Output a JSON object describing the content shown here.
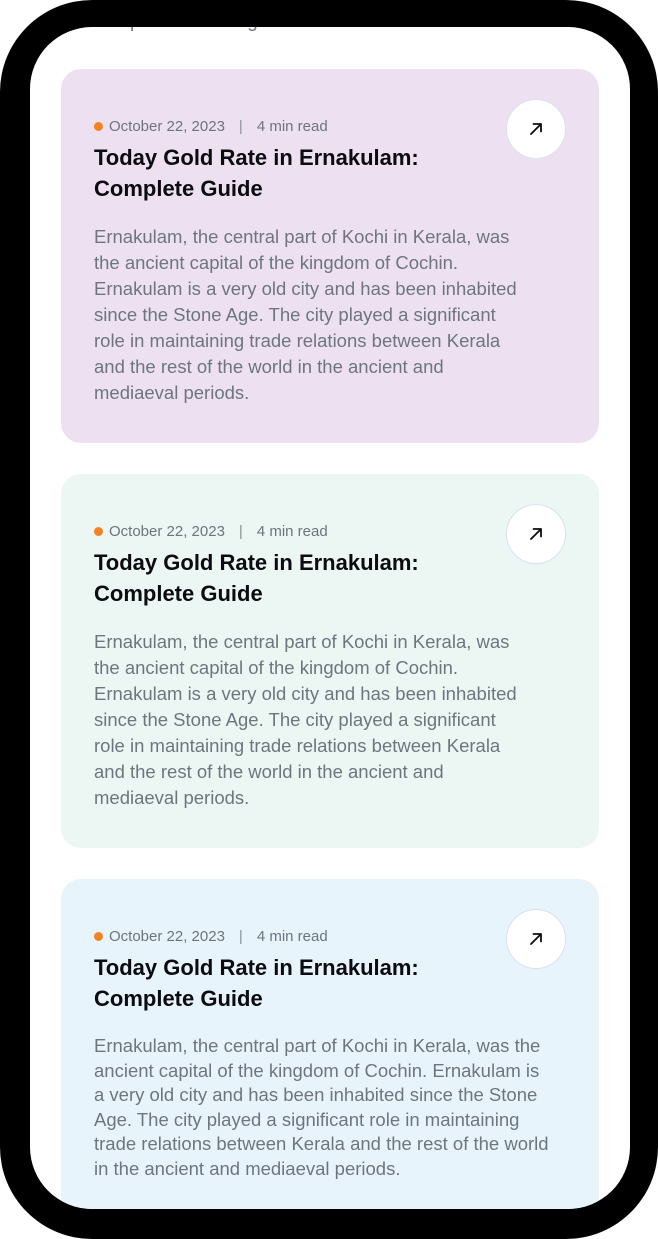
{
  "top_partial_text": "ncient capital of the kingdom of Cochin.",
  "cards": [
    {
      "date": "October 22, 2023",
      "separator": "|",
      "read_time": "4 min read",
      "title": "Today Gold Rate in Ernakulam: Complete Guide",
      "description": "Ernakulam, the central part of Kochi in Kerala, was the ancient capital of the kingdom of Cochin. Ernakulam is a very old city and has been inhabited since the Stone Age. The city played a significant role in maintaining trade relations between Kerala and the rest of the world in the ancient and mediaeval periods.",
      "icon": "arrow-up-right-icon",
      "background": "#ede1f1"
    },
    {
      "date": "October 22, 2023",
      "separator": "|",
      "read_time": "4 min read",
      "title": "Today Gold Rate in Ernakulam: Complete Guide",
      "description": "Ernakulam, the central part of Kochi in Kerala, was the ancient capital of the kingdom of Cochin. Ernakulam is a very old city and has been inhabited since the Stone Age. The city played a significant role in maintaining trade relations between Kerala and the rest of the world in the ancient and mediaeval periods.",
      "icon": "arrow-up-right-icon",
      "background": "#ecf7f4"
    },
    {
      "date": "October 22, 2023",
      "separator": "|",
      "read_time": "4 min read",
      "title": "Today Gold Rate in Ernakulam: Complete Guide",
      "description": "Ernakulam, the central part of Kochi in Kerala, was the ancient capital of the kingdom of Cochin. Ernakulam is a very old city and has been inhabited since the Stone Age. The city played a significant role in maintaining trade relations between Kerala and the rest of the world in the ancient and mediaeval periods.",
      "icon": "arrow-up-right-icon",
      "background": "#e8f4fc"
    }
  ],
  "colors": {
    "accent_dot": "#f58220",
    "title": "#0b0b10",
    "body_text": "#6e757e"
  }
}
